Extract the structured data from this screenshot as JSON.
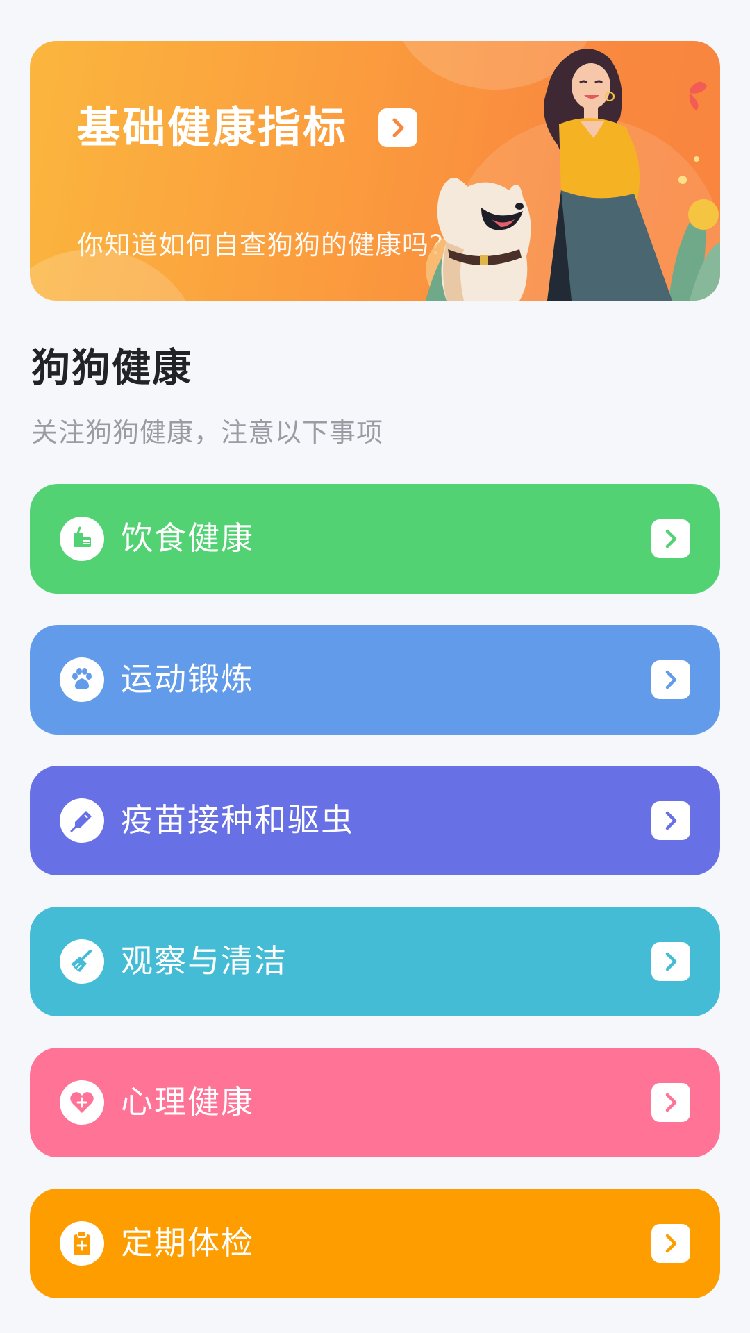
{
  "banner": {
    "title": "基础健康指标",
    "subtitle": "你知道如何自查狗狗的健康吗？",
    "arrow_icon": "chevron-right-icon",
    "illustration": "woman-with-dog-illustration",
    "gradient_start": "#FBB63E",
    "gradient_end": "#F9843E"
  },
  "section": {
    "title": "狗狗健康",
    "subtitle": "关注狗狗健康，注意以下事项"
  },
  "categories": [
    {
      "label": "饮食健康",
      "icon": "food-icon",
      "color": "#52D273"
    },
    {
      "label": "运动锻炼",
      "icon": "paw-icon",
      "color": "#619BEA"
    },
    {
      "label": "疫苗接种和驱虫",
      "icon": "syringe-icon",
      "color": "#6770E5"
    },
    {
      "label": "观察与清洁",
      "icon": "broom-icon",
      "color": "#45BCD6"
    },
    {
      "label": "心理健康",
      "icon": "heart-plus-icon",
      "color": "#FE7396"
    },
    {
      "label": "定期体检",
      "icon": "clipboard-medical-icon",
      "color": "#FE9D00"
    }
  ]
}
